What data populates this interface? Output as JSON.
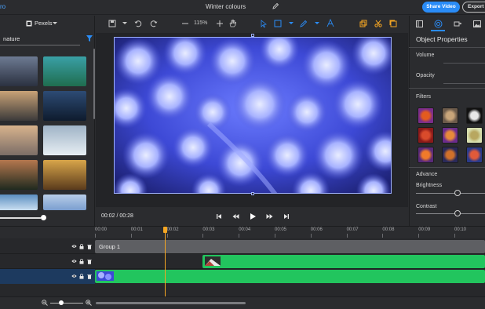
{
  "app": {
    "logo_text": "ro",
    "title": "Winter colours"
  },
  "header": {
    "share_label": "Share Video",
    "export_label": "Export Vi"
  },
  "left_panel": {
    "source_label": "Pexels",
    "search": {
      "value": "nature",
      "placeholder": ""
    },
    "thumbnails": [
      {
        "name": "mountain",
        "colors": [
          "#6d7a92",
          "#2b3140"
        ]
      },
      {
        "name": "coast",
        "colors": [
          "#3aa0a6",
          "#1f6d4f"
        ]
      },
      {
        "name": "windmill-sunset",
        "colors": [
          "#c9a277",
          "#3b3a3a"
        ]
      },
      {
        "name": "lake-night",
        "colors": [
          "#2d4b74",
          "#0e1b2d"
        ]
      },
      {
        "name": "clouds",
        "colors": [
          "#d8b38c",
          "#7b6d67"
        ]
      },
      {
        "name": "snow-hill",
        "colors": [
          "#9fb3c6",
          "#e7eef3"
        ]
      },
      {
        "name": "dusk-field",
        "colors": [
          "#b5774e",
          "#1f2a1f"
        ]
      },
      {
        "name": "autumn-road",
        "colors": [
          "#d8a54a",
          "#5a3b1c"
        ]
      },
      {
        "name": "sea",
        "colors": [
          "#5b8ec2",
          "#c9def0"
        ]
      },
      {
        "name": "sky",
        "colors": [
          "#b8cde8",
          "#7a9ecf"
        ]
      }
    ]
  },
  "toolbar": {
    "zoom": "115%"
  },
  "player": {
    "current": "00:02",
    "total": "/ 00:28"
  },
  "properties": {
    "title": "Object Properties",
    "volume_label": "Volume",
    "opacity_label": "Opacity",
    "filters_label": "Filters",
    "advance_label": "Advance",
    "brightness_label": "Brightness",
    "contrast_label": "Contrast",
    "filters": [
      {
        "colors": [
          "#7b2d8b",
          "#e35b1f"
        ]
      },
      {
        "colors": [
          "#6b5a4a",
          "#c8a57a"
        ]
      },
      {
        "colors": [
          "#111111",
          "#e8e8e8"
        ]
      },
      {
        "colors": [
          "#8a1a1a",
          "#d94b2b"
        ]
      },
      {
        "colors": [
          "#6a2c8c",
          "#e78a3a"
        ]
      },
      {
        "colors": [
          "#d8e0b0",
          "#b8a760"
        ]
      },
      {
        "colors": [
          "#5a2a7a",
          "#f07a2a"
        ]
      },
      {
        "colors": [
          "#2a2a5a",
          "#d0702a"
        ]
      },
      {
        "colors": [
          "#2a3a8a",
          "#e05a3a"
        ]
      }
    ],
    "brightness_level": 0.6,
    "contrast_level": 0.6
  },
  "timeline": {
    "ticks": [
      "00:00",
      "00:01",
      "00:02",
      "00:03",
      "00:04",
      "00:05",
      "00:06",
      "00:07",
      "00:08",
      "00:09",
      "00:10"
    ],
    "group_label": "Group 1"
  },
  "colors": {
    "accent": "#2a8cf7",
    "clip": "#22c55e",
    "playhead": "#f5a623"
  }
}
